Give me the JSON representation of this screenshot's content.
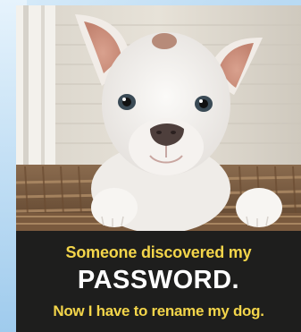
{
  "caption": {
    "line1": "Someone discovered my",
    "line2": "PASSWORD.",
    "line3": "Now I have to rename my dog."
  },
  "image": {
    "subject": "white-puppy-photo",
    "colors": {
      "caption_background": "#1e1e1d",
      "caption_yellow": "#f3d54a",
      "caption_white": "#ffffff"
    }
  }
}
